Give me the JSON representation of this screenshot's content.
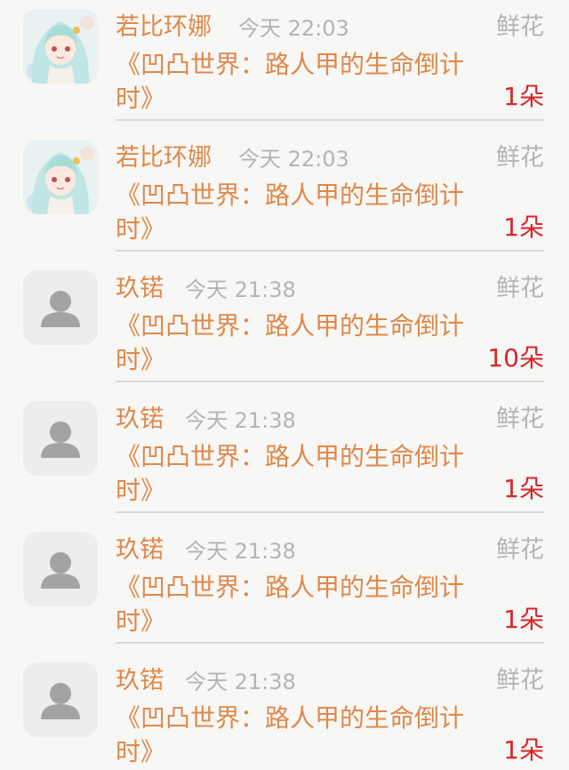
{
  "items": [
    {
      "user": "若比环娜",
      "time": "今天 22:03",
      "type": "鲜花",
      "book": "《凹凸世界：路人甲的生命倒计时》",
      "count": "1朵",
      "avatar": "anime-girl-avatar"
    },
    {
      "user": "若比环娜",
      "time": "今天 22:03",
      "type": "鲜花",
      "book": "《凹凸世界：路人甲的生命倒计时》",
      "count": "1朵",
      "avatar": "anime-girl-avatar"
    },
    {
      "user": "玖锘",
      "time": "今天 21:38",
      "type": "鲜花",
      "book": "《凹凸世界：路人甲的生命倒计时》",
      "count": "10朵",
      "avatar": "default-user-icon"
    },
    {
      "user": "玖锘",
      "time": "今天 21:38",
      "type": "鲜花",
      "book": "《凹凸世界：路人甲的生命倒计时》",
      "count": "1朵",
      "avatar": "default-user-icon"
    },
    {
      "user": "玖锘",
      "time": "今天 21:38",
      "type": "鲜花",
      "book": "《凹凸世界：路人甲的生命倒计时》",
      "count": "1朵",
      "avatar": "default-user-icon"
    },
    {
      "user": "玖锘",
      "time": "今天 21:38",
      "type": "鲜花",
      "book": "《凹凸世界：路人甲的生命倒计时》",
      "count": "1朵",
      "avatar": "default-user-icon"
    }
  ],
  "colors": {
    "accent": "#e0884a",
    "muted": "#b4b4b4",
    "count": "#d8262a",
    "divider": "#d9d9d9",
    "background": "#f7f7f5"
  }
}
